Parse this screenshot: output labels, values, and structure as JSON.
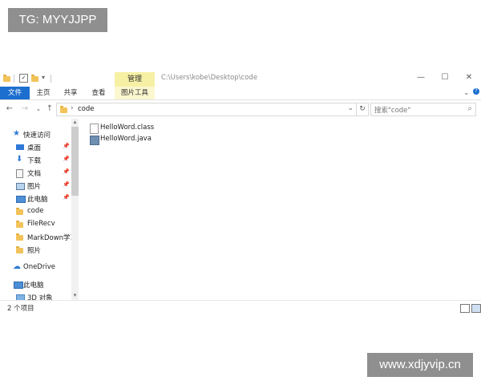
{
  "watermark_top": "TG: MYYJJPP",
  "watermark_bottom": "www.xdjyvip.cn",
  "titlebar": {
    "context_tab": "管理",
    "path": "C:\\Users\\kobe\\Desktop\\code",
    "controls": [
      "—",
      "☐",
      "✕"
    ]
  },
  "ribbon": {
    "tabs": [
      "文件",
      "主页",
      "共享",
      "查看",
      "图片工具"
    ]
  },
  "address": {
    "breadcrumb": "code",
    "search_placeholder": "搜索\"code\""
  },
  "nav": {
    "items": [
      {
        "label": "快速访问",
        "icon": "star-icon"
      },
      {
        "label": "桌面",
        "icon": "desktop-icon",
        "pinned": true
      },
      {
        "label": "下载",
        "icon": "download-icon",
        "pinned": true
      },
      {
        "label": "文档",
        "icon": "document-icon",
        "pinned": true
      },
      {
        "label": "图片",
        "icon": "pictures-icon",
        "pinned": true
      },
      {
        "label": "此电脑",
        "icon": "computer-icon",
        "pinned": true
      },
      {
        "label": "code",
        "icon": "folder-icon"
      },
      {
        "label": "FileRecv",
        "icon": "folder-icon"
      },
      {
        "label": "MarkDown学习",
        "icon": "folder-icon"
      },
      {
        "label": "照片",
        "icon": "folder-icon"
      },
      {
        "label": "OneDrive",
        "icon": "cloud-icon"
      },
      {
        "label": "此电脑",
        "icon": "computer-icon"
      },
      {
        "label": "3D 对象",
        "icon": "3d-objects-icon"
      }
    ]
  },
  "files": [
    {
      "name": "HelloWord.class",
      "icon": "file-icon"
    },
    {
      "name": "HelloWord.java",
      "icon": "java-file-icon"
    }
  ],
  "status": {
    "item_count": "2 个项目"
  },
  "colors": {
    "file_tab": "#1c6fcf",
    "manage_tab": "#f6f0a4",
    "watermark_bg": "#8f8f8f"
  }
}
